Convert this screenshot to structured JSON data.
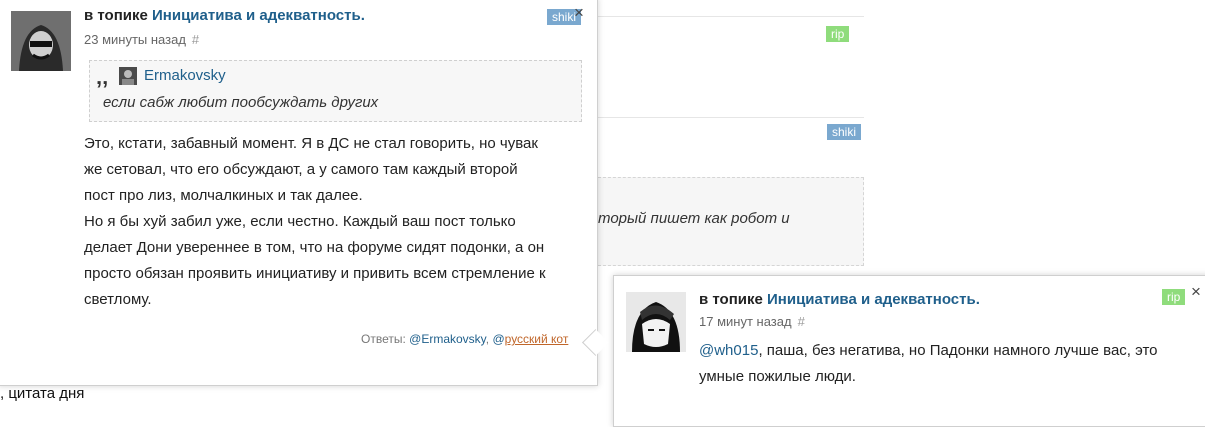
{
  "background": {
    "tag_rip": "rip",
    "tag_shiki": "shiki",
    "quote_fragment": "торый пишет как робот и",
    "caption": ", цитата дня"
  },
  "popup1": {
    "tag": "shiki",
    "in_topic_prefix": "в топике",
    "topic": "Инициатива и адекватность.",
    "time": "23 минуты назад",
    "hash": "#",
    "quote": {
      "author": "Ermakovsky",
      "text": "если сабж любит пообсуждать других"
    },
    "body_lines": [
      "Это, кстати, забавный момент. Я в ДС не стал говорить, но чувак",
      "же сетовал, что его обсуждают, а у самого там каждый второй",
      "пост про лиз, молчалкиных и так далее.",
      "Но я бы хуй забил уже, если честно. Каждый ваш пост только",
      "делает Дони увереннее в том, что на форуме сидят подонки, а он",
      "просто обязан проявить инициативу и привить всем стремление к",
      "светлому."
    ],
    "replies_label": "Ответы:",
    "reply1": "@Ermakovsky",
    "reply2": "русский кот"
  },
  "popup2": {
    "tag": "rip",
    "in_topic_prefix": "в топике",
    "topic": "Инициатива и адекватность.",
    "time": "17 минут назад",
    "hash": "#",
    "mention": "@wh015",
    "line1_rest": ", паша, без негатива, но Падонки намного лучше вас, это",
    "line2": "умные пожилые люди."
  }
}
